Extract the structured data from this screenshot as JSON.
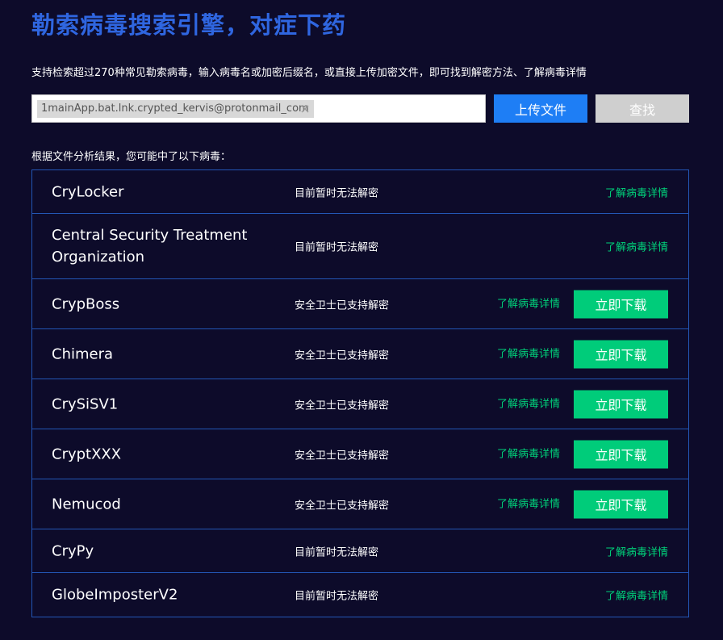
{
  "header": {
    "title": "勒索病毒搜索引擎，对症下药",
    "description": "支持检索超过270种常见勒索病毒，输入病毒名或加密后缀名，或直接上传加密文件，即可找到解密方法、了解病毒详情"
  },
  "search": {
    "file_tag": "1mainApp.bat.lnk.crypted_kervis@protonmail_com",
    "tag_close_glyph": "×",
    "upload_label": "上传文件",
    "search_label": "查找"
  },
  "results": {
    "caption": "根据文件分析结果，您可能中了以下病毒：",
    "rows": [
      {
        "name": "CryLocker",
        "status": "目前暂时无法解密",
        "detail": "了解病毒详情",
        "download": null
      },
      {
        "name": "Central Security Treatment Organization",
        "status": "目前暂时无法解密",
        "detail": "了解病毒详情",
        "download": null
      },
      {
        "name": "CrypBoss",
        "status": "安全卫士已支持解密",
        "detail": "了解病毒详情",
        "download": "立即下载"
      },
      {
        "name": "Chimera",
        "status": "安全卫士已支持解密",
        "detail": "了解病毒详情",
        "download": "立即下载"
      },
      {
        "name": "CrySiSV1",
        "status": "安全卫士已支持解密",
        "detail": "了解病毒详情",
        "download": "立即下载"
      },
      {
        "name": "CryptXXX",
        "status": "安全卫士已支持解密",
        "detail": "了解病毒详情",
        "download": "立即下载"
      },
      {
        "name": "Nemucod",
        "status": "安全卫士已支持解密",
        "detail": "了解病毒详情",
        "download": "立即下载"
      },
      {
        "name": "CryPy",
        "status": "目前暂时无法解密",
        "detail": "了解病毒详情",
        "download": null
      },
      {
        "name": "GlobeImposterV2",
        "status": "目前暂时无法解密",
        "detail": "了解病毒详情",
        "download": null
      }
    ]
  },
  "colors": {
    "background": "#0d0b2a",
    "title": "#2f66e0",
    "upload_button": "#1e7ef5",
    "search_button": "#cfcfcf",
    "download_button": "#00cc7a",
    "detail_link": "#00d27a",
    "table_border": "#2356b5"
  },
  "icons": {
    "tag_close": "close-icon"
  }
}
